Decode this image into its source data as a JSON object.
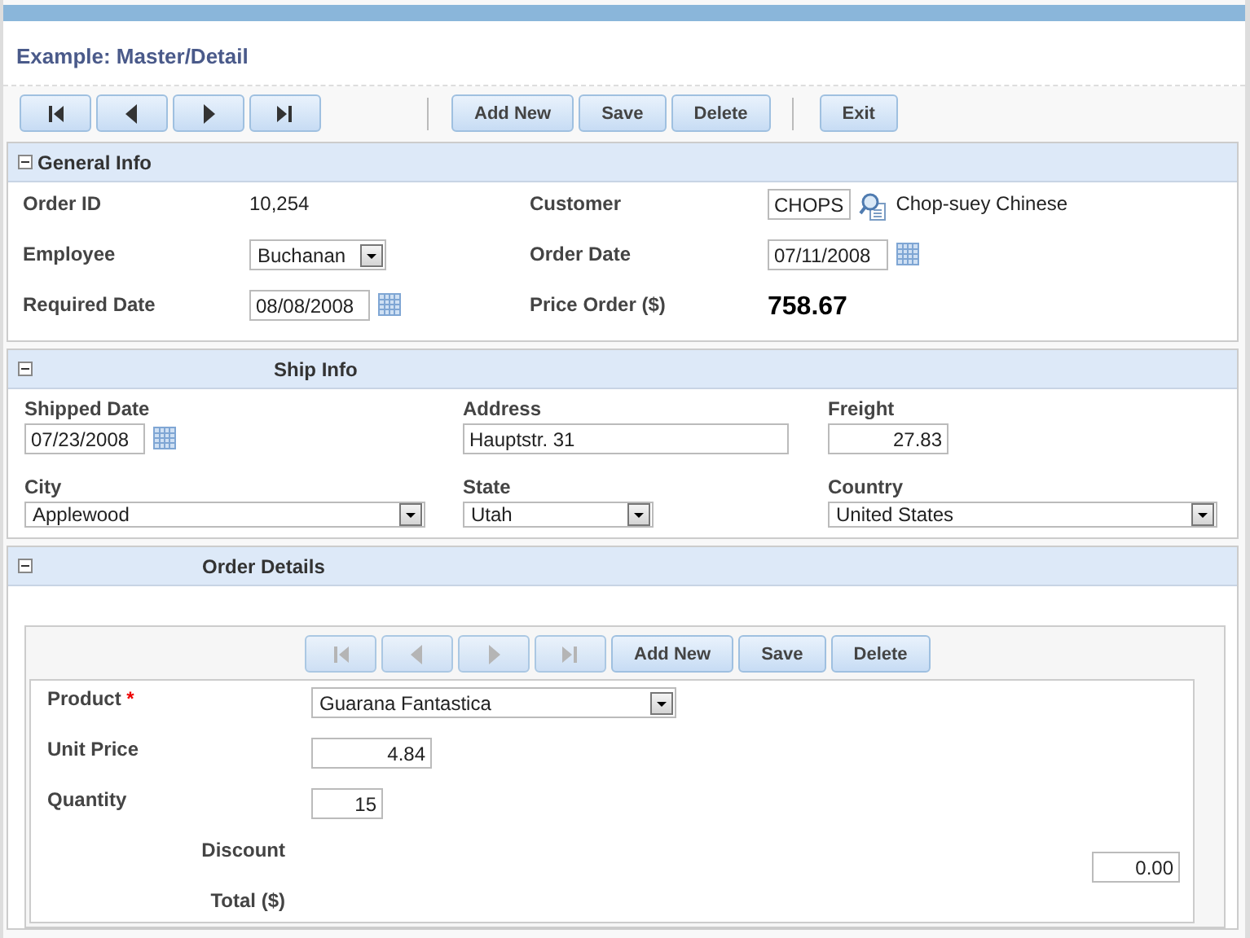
{
  "title": "Example: Master/Detail",
  "toolbar": {
    "nav": [
      {
        "kind": "first",
        "disabled": false
      },
      {
        "kind": "prev",
        "disabled": false
      },
      {
        "kind": "next",
        "disabled": false
      },
      {
        "kind": "last",
        "disabled": false
      }
    ],
    "buttons": [
      {
        "label": "Add New",
        "kind": "action"
      },
      {
        "label": "Save",
        "kind": "action"
      },
      {
        "label": "Delete",
        "kind": "action"
      },
      {
        "label": "Exit",
        "kind": "exit"
      }
    ]
  },
  "general_info": {
    "title": "General Info",
    "expanded": true,
    "order_id": {
      "label": "Order ID",
      "value": "10,254"
    },
    "customer": {
      "label": "Customer",
      "code": "CHOPS",
      "name": "Chop-suey Chinese"
    },
    "employee": {
      "label": "Employee",
      "value": "Buchanan"
    },
    "order_date": {
      "label": "Order Date",
      "value": "07/11/2008"
    },
    "required_date": {
      "label": "Required Date",
      "value": "08/08/2008"
    },
    "price_order": {
      "label": "Price Order ($)",
      "value": "758.67"
    }
  },
  "ship_info": {
    "title": "Ship Info",
    "expanded": true,
    "shipped_date": {
      "label": "Shipped Date",
      "value": "07/23/2008"
    },
    "address": {
      "label": "Address",
      "value": "Hauptstr. 31"
    },
    "freight": {
      "label": "Freight",
      "value": "27.83"
    },
    "city": {
      "label": "City",
      "value": "Applewood"
    },
    "state": {
      "label": "State",
      "value": "Utah"
    },
    "country": {
      "label": "Country",
      "value": "United States"
    }
  },
  "order_details": {
    "title": "Order Details",
    "expanded": true,
    "nav": [
      {
        "kind": "first",
        "disabled": true
      },
      {
        "kind": "prev",
        "disabled": true
      },
      {
        "kind": "next",
        "disabled": true
      },
      {
        "kind": "last",
        "disabled": true
      }
    ],
    "buttons": [
      {
        "label": "Add New"
      },
      {
        "label": "Save"
      },
      {
        "label": "Delete"
      }
    ],
    "product": {
      "label": "Product",
      "required_mark": "*",
      "value": "Guarana Fantastica"
    },
    "unit_price": {
      "label": "Unit Price",
      "value": "4.84"
    },
    "quantity": {
      "label": "Quantity",
      "value": "15"
    },
    "discount": {
      "label": "Discount",
      "value": "0.00"
    },
    "total": {
      "label": "Total ($)"
    }
  }
}
